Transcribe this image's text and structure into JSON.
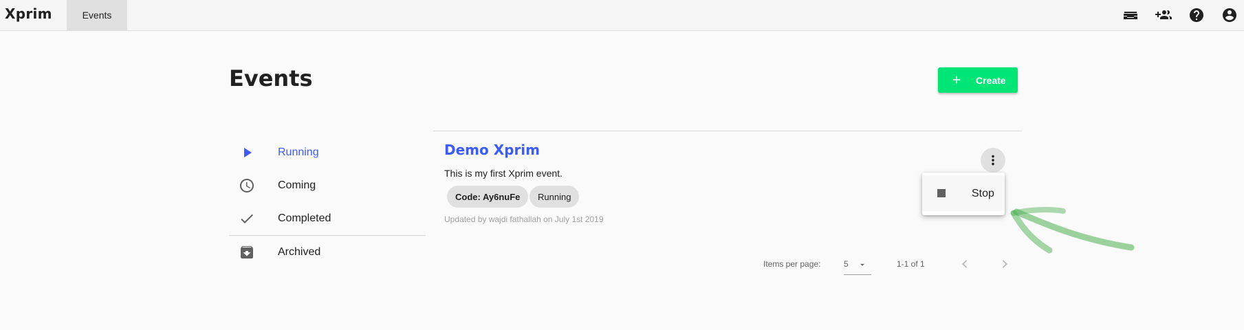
{
  "app": {
    "logo": "Xprim"
  },
  "nav": {
    "tabs": [
      {
        "label": "Events",
        "active": true
      }
    ]
  },
  "topbar_icons": [
    "inbox-icon",
    "group-add-icon",
    "help-icon",
    "account-icon"
  ],
  "page": {
    "title": "Events",
    "create_label": "Create"
  },
  "sidebar": {
    "items": [
      {
        "label": "Running",
        "icon": "play-icon",
        "active": true
      },
      {
        "label": "Coming",
        "icon": "clock-icon",
        "active": false
      },
      {
        "label": "Completed",
        "icon": "check-icon",
        "active": false
      },
      {
        "label": "Archived",
        "icon": "archive-icon",
        "active": false
      }
    ]
  },
  "event": {
    "title": "Demo Xprim",
    "description": "This is my first Xprim event.",
    "code_chip": "Code: Ay6nuFe",
    "status_chip": "Running",
    "meta": "Updated by wajdi fathallah on July 1st 2019"
  },
  "context_menu": {
    "items": [
      {
        "label": "Stop",
        "icon": "stop-icon"
      }
    ]
  },
  "pagination": {
    "items_per_page_label": "Items per page:",
    "items_per_page_value": "5",
    "range": "1-1 of 1"
  },
  "colors": {
    "accent": "#3d5afe",
    "create_button": "#00e676",
    "annotation_arrow": "#4caf50"
  }
}
